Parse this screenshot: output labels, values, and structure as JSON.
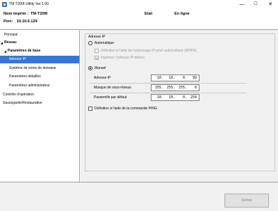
{
  "window": {
    "title": "TM-T20III Utility Ver.1.00",
    "controls": {
      "minimize": "—",
      "maximize": "☐",
      "close": "✕"
    }
  },
  "header": {
    "printer_name_label": "Nom imprim :",
    "printer_name_value": "TM-T20III",
    "port_label": "Port:",
    "port_value": "10.10.0.129",
    "status_label": "Etat:",
    "status_value": "En ligne"
  },
  "sidebar": {
    "items": [
      {
        "label": "Principal",
        "arrow": "",
        "bold": false,
        "selected": false
      },
      {
        "label": "Réseau",
        "arrow": "◢",
        "bold": true,
        "selected": false
      },
      {
        "label": "Paramètres de base",
        "arrow": "◢",
        "bold": true,
        "selected": false
      },
      {
        "label": "Adresse IP",
        "arrow": "",
        "bold": false,
        "selected": true
      },
      {
        "label": "Système de noms de domaine",
        "arrow": "",
        "bold": false,
        "selected": false
      },
      {
        "label": "Paramètres détaillés",
        "arrow": "",
        "bold": false,
        "selected": false
      },
      {
        "label": "Paramètres administrateur",
        "arrow": "",
        "bold": false,
        "selected": false
      },
      {
        "label": "Contrôle d'opération",
        "arrow": "",
        "bold": false,
        "selected": false
      },
      {
        "label": "Sauvegarde/Restauration",
        "arrow": "",
        "bold": false,
        "selected": false
      }
    ]
  },
  "ip_settings": {
    "group_title": "Adresse IP",
    "auto_label": "Automatique",
    "auto_selected": false,
    "apipa_label": "Définition à l'aide de l'adressage IP privé automatique (APIPA)",
    "apipa_checked": false,
    "print_ip_label": "Imprimer l'adresse IP définie.",
    "print_ip_checked": true,
    "manual_label": "Manuel",
    "manual_selected": true,
    "ip_label": "Adresse IP",
    "ip_value": [
      "10",
      "10",
      "0",
      "99"
    ],
    "subnet_label": "Masque de sous-réseau",
    "subnet_value": [
      "255",
      "255",
      "255",
      "0"
    ],
    "gateway_label": "Passerelle par défaut",
    "gateway_value": [
      "10",
      "10",
      "0",
      "254"
    ],
    "ping_label": "Définition à l'aide de la commande PING",
    "ping_checked": false
  },
  "footer": {
    "apply_label": "Définir"
  }
}
